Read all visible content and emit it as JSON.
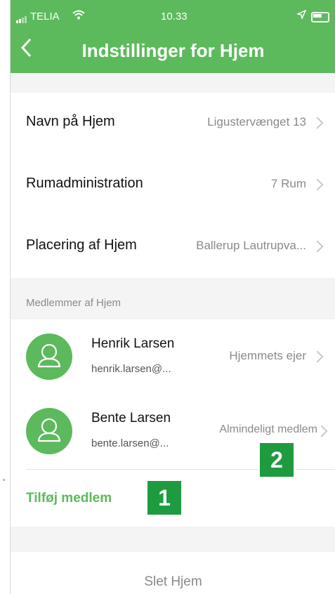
{
  "statusbar": {
    "carrier": "TELIA",
    "time": "10.33"
  },
  "header": {
    "title": "Indstillinger for Hjem"
  },
  "settings": [
    {
      "label": "Navn på Hjem",
      "value": "Ligustervænget 13"
    },
    {
      "label": "Rumadministration",
      "value": "7 Rum"
    },
    {
      "label": "Placering af Hjem",
      "value": "Ballerup Lautrupva..."
    }
  ],
  "members_title": "Medlemmer af Hjem",
  "members": [
    {
      "name": "Henrik Larsen",
      "email": "henrik.larsen@...",
      "role": "Hjemmets ejer"
    },
    {
      "name": "Bente Larsen",
      "email": "bente.larsen@...",
      "role": "Almindeligt medlem"
    }
  ],
  "add_member": "Tilføj medlem",
  "badges": [
    "1",
    "2"
  ],
  "delete_home": "Slet Hjem",
  "colors": {
    "brand": "#5cba5c",
    "badge": "#1f9b3f"
  }
}
